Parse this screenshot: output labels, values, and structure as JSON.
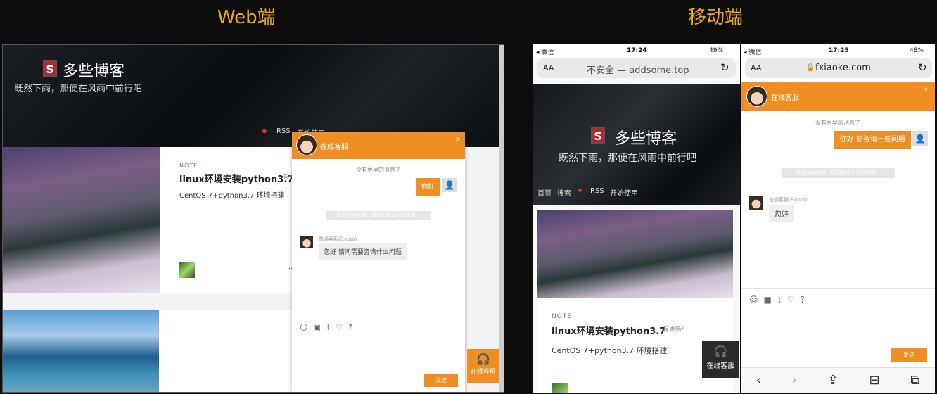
{
  "labels": {
    "web": "Web端",
    "mobile": "移动端"
  },
  "blog": {
    "title": "多些博客",
    "subtitle": "既然下雨，那便在风雨中前行吧",
    "logo_letter": "S",
    "nav_web": [
      "RSS",
      "开始使用"
    ],
    "nav_mobile": [
      "首页",
      "搜索",
      "RSS",
      "开始使用"
    ]
  },
  "post": {
    "tag": "NOTE",
    "title": "linux环境安装python3.7",
    "badge": "有更新!",
    "badge_web": "有更",
    "subtitle": "CentOS 7+python3.7 环境搭建",
    "more": "..."
  },
  "chat_web": {
    "title": "在线客服",
    "close": "x",
    "no_more": "没有更早的消息了",
    "my_msg": "你好",
    "notice": "欢迎访问官网，请问有什么可以帮您。",
    "agent_name": "普通客服(Robin)",
    "agent_msg": "您好  请问需要咨询什么问题",
    "send": "发送",
    "float_btn": "在线客服"
  },
  "phone1": {
    "carrier": "◂ 微信",
    "time": "17:24",
    "battery": "49%",
    "aa": "AA",
    "url": "不安全 — addsome.top",
    "float_btn": "在线客服"
  },
  "phone2": {
    "carrier": "◂ 微信",
    "time": "17:25",
    "battery": "48%",
    "aa": "AA",
    "url": "fxiaoke.com",
    "chat_title": "在线客服",
    "close": "x",
    "no_more": "没有更早的消息了",
    "my_msg": "你好 想咨询一些问题",
    "notice": "欢迎访问官网，请问有什么可以帮您。",
    "agent_name": "普通客服(Robin)",
    "agent_msg": "您好",
    "send": "发送"
  },
  "colors": {
    "accent": "#f08e23",
    "label": "#f0a818",
    "dark_btn": "#2a2a2a"
  },
  "icons": [
    "emoji-icon",
    "image-icon",
    "attach-icon",
    "heart-icon",
    "help-icon",
    "headset-icon",
    "reload-icon",
    "lock-icon",
    "back-icon",
    "forward-icon",
    "share-icon",
    "bookmarks-icon",
    "tabs-icon"
  ]
}
